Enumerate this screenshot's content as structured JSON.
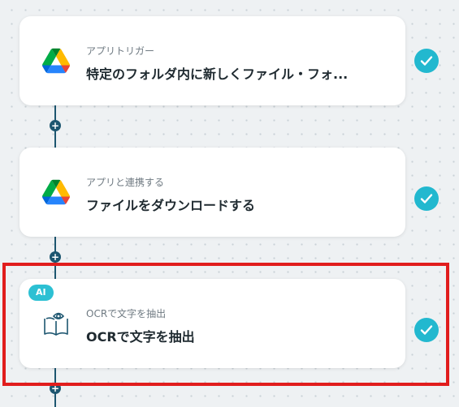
{
  "steps": [
    {
      "subtitle": "アプリトリガー",
      "title": "特定のフォルダ内に新しくファイル・フォ...",
      "icon": "google-drive-icon",
      "status": "completed"
    },
    {
      "subtitle": "アプリと連携する",
      "title": "ファイルをダウンロードする",
      "icon": "google-drive-icon",
      "status": "completed"
    },
    {
      "badge": "AI",
      "subtitle": "OCRで文字を抽出",
      "title": "OCRで文字を抽出",
      "icon": "book-eye-icon",
      "status": "completed"
    }
  ],
  "add_button_label": "+",
  "colors": {
    "connector": "#1d5670",
    "check": "#22b8cf",
    "ai_badge": "#2cc0d3",
    "highlight": "#e11d1d"
  }
}
